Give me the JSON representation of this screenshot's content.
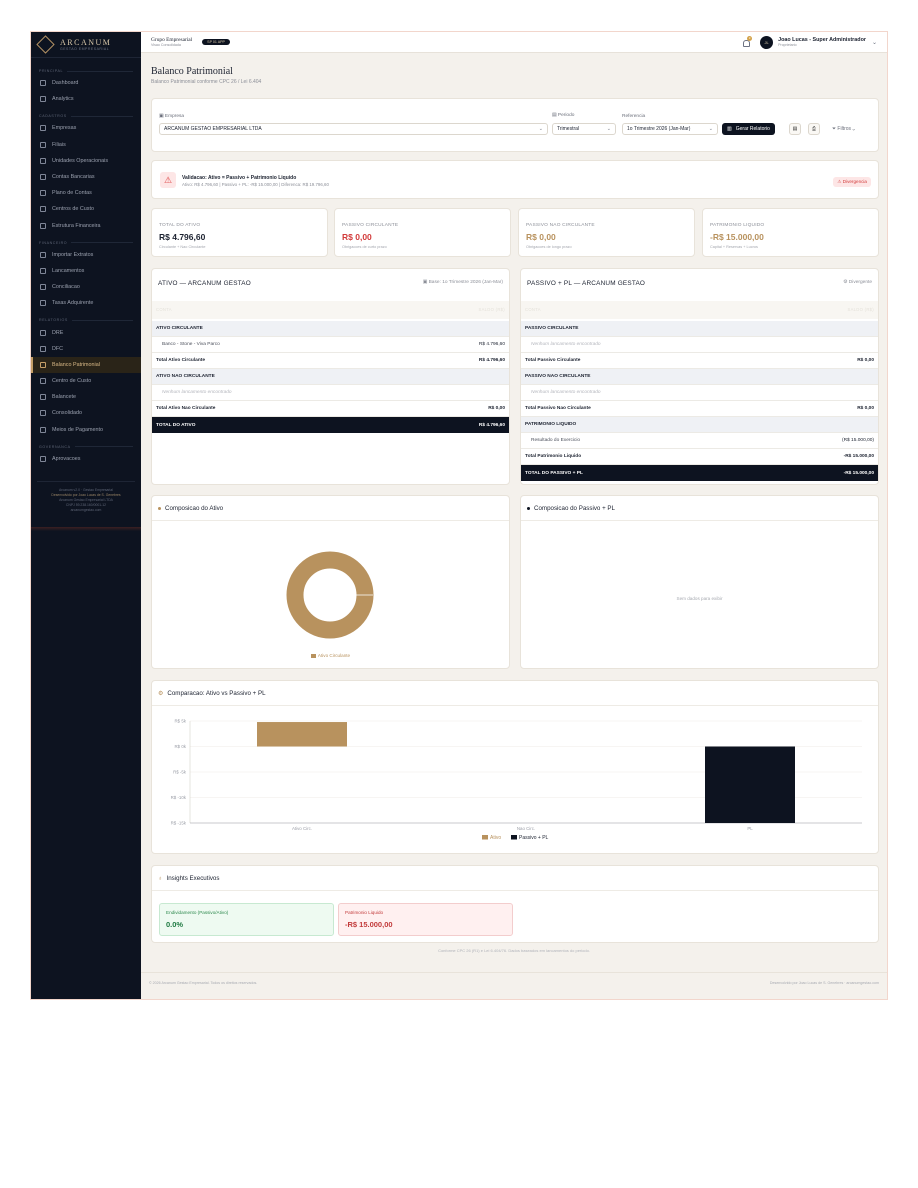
{
  "brand": {
    "name": "ARCANUM",
    "subtitle": "GESTAO EMPRESARIAL"
  },
  "sidebar": {
    "sections": [
      {
        "title": "PRINCIPAL",
        "items": [
          {
            "label": "Dashboard",
            "icon": "grid-icon"
          },
          {
            "label": "Analytics",
            "icon": "pie-icon"
          }
        ]
      },
      {
        "title": "CADASTROS",
        "items": [
          {
            "label": "Empresas",
            "icon": "building-icon"
          },
          {
            "label": "Filiais",
            "icon": "branch-icon"
          },
          {
            "label": "Unidades Operacionais",
            "icon": "unit-icon"
          },
          {
            "label": "Contas Bancarias",
            "icon": "bank-icon"
          },
          {
            "label": "Plano de Contas",
            "icon": "book-icon"
          },
          {
            "label": "Centros de Custo",
            "icon": "cost-center-icon"
          },
          {
            "label": "Estrutura Financeira",
            "icon": "hierarchy-icon"
          }
        ]
      },
      {
        "title": "FINANCEIRO",
        "items": [
          {
            "label": "Importar Extratos",
            "icon": "upload-icon"
          },
          {
            "label": "Lancamentos",
            "icon": "arrows-icon"
          },
          {
            "label": "Conciliacao",
            "icon": "check-square-icon"
          },
          {
            "label": "Taxas Adquirente",
            "icon": "card-icon"
          }
        ]
      },
      {
        "title": "RELATORIOS",
        "items": [
          {
            "label": "DRE",
            "icon": "report-icon"
          },
          {
            "label": "DFC",
            "icon": "trend-icon"
          },
          {
            "label": "Balanco Patrimonial",
            "icon": "scale-icon",
            "active": true
          },
          {
            "label": "Centro de Custo",
            "icon": "cost-center-icon"
          },
          {
            "label": "Balancete",
            "icon": "list-icon"
          },
          {
            "label": "Consolidado",
            "icon": "layers-icon"
          },
          {
            "label": "Meios de Pagamento",
            "icon": "wallet-icon"
          }
        ]
      },
      {
        "title": "GOVERNANCA",
        "items": [
          {
            "label": "Aprovacoes",
            "icon": "approve-icon"
          }
        ]
      }
    ],
    "footer": {
      "line1": "Arcanum v2.0 · Gestao Empresarial",
      "line2": "Desenvolvido por Joao Lucas de S. Genebres",
      "line3": "Arcanum Gestao Empresarial LTDA",
      "line4": "CNPJ 59.238.160/0001-12",
      "line5": "arcanumgestao.com"
    }
  },
  "topbar": {
    "org": "Grupo Empresarial",
    "org_sub": "Visao Consolidada",
    "cnpj": "SP 01 APP",
    "notifications": "3",
    "user_initials": "JL",
    "user_name": "Joao Lucas - Super Administrador",
    "user_role": "Proprietario"
  },
  "page": {
    "title": "Balanco Patrimonial",
    "subtitle": "Balanco Patrimonial conforme CPC 26 / Lei 6.404"
  },
  "filters": {
    "empresa_label": "Empresa",
    "empresa_value": "ARCANUM GESTAO EMPRESARIAL LTDA",
    "periodo_label": "Periodo",
    "periodo_value": "Trimestral",
    "referencia_label": "Referencia",
    "referencia_value": "1o Trimestre 2026 (Jan-Mar)",
    "gerar_label": "Gerar Relatorio",
    "filtros_label": "Filtros"
  },
  "validation": {
    "title": "Validacao: Ativo = Passivo + Patrimonio Liquido",
    "detail": "Ativo: R$ 4.796,60 | Passivo + PL: -R$ 15.000,00 | Diferenca: R$ 19.796,60",
    "badge": "Divergencia",
    "colors": {
      "badge_bg": "#fde6e6",
      "badge_text": "#d23a3a"
    }
  },
  "kpis": [
    {
      "label": "TOTAL DO ATIVO",
      "value": "R$ 4.796,60",
      "sub": "Circulante + Nao Circulante",
      "color": "#1c2230"
    },
    {
      "label": "PASSIVO CIRCULANTE",
      "value": "R$ 0,00",
      "sub": "Obrigacoes de curto prazo",
      "color": "#d23a3a"
    },
    {
      "label": "PASSIVO NAO CIRCULANTE",
      "value": "R$ 0,00",
      "sub": "Obrigacoes de longo prazo",
      "color": "#b8925e"
    },
    {
      "label": "PATRIMONIO LIQUIDO",
      "value": "-R$ 15.000,00",
      "sub": "Capital + Reservas + Lucros",
      "color": "#b8925e"
    }
  ],
  "ativo": {
    "title": "ATIVO — ARCANUM GESTAO",
    "base": "Base: 1o Trimestre 2026 (Jan-Mar)",
    "header_left": "CONTA",
    "header_right": "SALDO (R$)",
    "rows": [
      {
        "type": "group",
        "label": "ATIVO CIRCULANTE",
        "amount": ""
      },
      {
        "type": "sub",
        "label": "Banco - Stone - Viva Parco",
        "amount": "R$ 4.796,60"
      },
      {
        "type": "tot",
        "label": "Total Ativo Circulante",
        "amount": "R$ 4.796,60"
      },
      {
        "type": "group",
        "label": "ATIVO NAO CIRCULANTE",
        "amount": ""
      },
      {
        "type": "empty",
        "label": "Nenhum lancamento encontrado",
        "amount": ""
      },
      {
        "type": "tot",
        "label": "Total Ativo Nao Circulante",
        "amount": "R$ 0,00"
      },
      {
        "type": "grand",
        "label": "TOTAL DO ATIVO",
        "amount": "R$ 4.796,60"
      }
    ]
  },
  "passivo": {
    "title": "PASSIVO + PL — ARCANUM GESTAO",
    "badge": "Divergente",
    "header_left": "CONTA",
    "header_right": "SALDO (R$)",
    "rows": [
      {
        "type": "group",
        "label": "PASSIVO CIRCULANTE",
        "amount": ""
      },
      {
        "type": "empty",
        "label": "Nenhum lancamento encontrado",
        "amount": ""
      },
      {
        "type": "tot",
        "label": "Total Passivo Circulante",
        "amount": "R$ 0,00"
      },
      {
        "type": "group",
        "label": "PASSIVO NAO CIRCULANTE",
        "amount": ""
      },
      {
        "type": "empty",
        "label": "Nenhum lancamento encontrado",
        "amount": ""
      },
      {
        "type": "tot",
        "label": "Total Passivo Nao Circulante",
        "amount": "R$ 0,00"
      },
      {
        "type": "group",
        "label": "PATRIMONIO LIQUIDO",
        "amount": ""
      },
      {
        "type": "sub",
        "label": "Resultado do Exercicio",
        "amount": "(R$ 15.000,00)",
        "red": true
      },
      {
        "type": "tot",
        "label": "Total Patrimonio Liquido",
        "amount": "-R$ 15.000,00"
      },
      {
        "type": "grand",
        "label": "TOTAL DO PASSIVO + PL",
        "amount": "-R$ 15.000,00"
      }
    ]
  },
  "composicao_ativo": {
    "title": "Composicao do Ativo",
    "legend": "Ativo Circulante",
    "color": "#b8925e"
  },
  "composicao_passivo": {
    "title": "Composicao do Passivo + PL",
    "empty": "Sem dados para exibir"
  },
  "comparacao": {
    "title": "Comparacao: Ativo vs Passivo + PL"
  },
  "chart_data": {
    "type": "bar",
    "title": "Comparacao: Ativo vs Passivo + PL",
    "categories": [
      "Ativo Circ.",
      "Nao Circ.",
      "PL"
    ],
    "series": [
      {
        "name": "Ativo",
        "values": [
          4796.6,
          0,
          0
        ],
        "color": "#b8925e"
      },
      {
        "name": "Passivo + PL",
        "values": [
          0,
          0,
          -15000
        ],
        "color": "#0d1320"
      }
    ],
    "y_ticks": [
      "R$ 5k",
      "R$ 0k",
      "R$ -5k",
      "R$ -10k",
      "R$ -15k"
    ],
    "ylim": [
      -15000,
      5000
    ],
    "grid": true,
    "legend": "bottom-center"
  },
  "insights": {
    "title": "Insights Executivos",
    "cards": [
      {
        "label": "Endividamento (Passivo/Ativo)",
        "value": "0.0%"
      },
      {
        "label": "Patrimonio Liquido",
        "value": "-R$ 15.000,00"
      }
    ]
  },
  "note": "Conforme CPC 26 (R1) e Lei 6.404/76. Dados baseados em lancamentos do periodo.",
  "footer": {
    "left": "© 2026 Arcanum Gestao Empresarial. Todos os direitos reservados.",
    "right": "Desenvolvido por Joao Lucas de S. Genebres · arcanumgestao.com"
  }
}
